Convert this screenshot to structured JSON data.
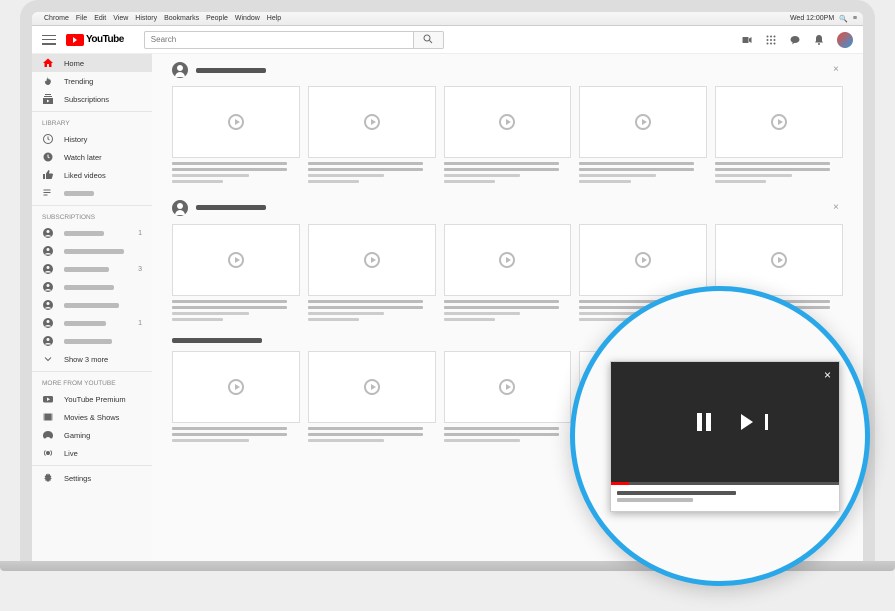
{
  "macbar": {
    "menus": [
      "Chrome",
      "File",
      "Edit",
      "View",
      "History",
      "Bookmarks",
      "People",
      "Window",
      "Help"
    ],
    "clock": "Wed 12:00PM"
  },
  "header": {
    "logo_text": "YouTube",
    "search_placeholder": "Search"
  },
  "sidebar": {
    "primary": [
      {
        "icon": "home",
        "label": "Home",
        "active": true
      },
      {
        "icon": "trending",
        "label": "Trending"
      },
      {
        "icon": "subs",
        "label": "Subscriptions"
      }
    ],
    "library_header": "LIBRARY",
    "library": [
      {
        "icon": "history",
        "label": "History"
      },
      {
        "icon": "clock",
        "label": "Watch later"
      },
      {
        "icon": "like",
        "label": "Liked videos"
      },
      {
        "icon": "playlist",
        "label": ""
      }
    ],
    "subs_header": "SUBSCRIPTIONS",
    "subs": [
      {
        "count": "1"
      },
      {
        "count": ""
      },
      {
        "count": "3"
      },
      {
        "count": ""
      },
      {
        "count": ""
      },
      {
        "count": "1"
      },
      {
        "count": ""
      }
    ],
    "show_more": "Show 3 more",
    "more_header": "MORE FROM YOUTUBE",
    "more": [
      {
        "icon": "premium",
        "label": "YouTube Premium"
      },
      {
        "icon": "movies",
        "label": "Movies & Shows"
      },
      {
        "icon": "gaming",
        "label": "Gaming"
      },
      {
        "icon": "live",
        "label": "Live"
      }
    ],
    "settings": "Settings"
  },
  "pip": {
    "close": "×"
  }
}
